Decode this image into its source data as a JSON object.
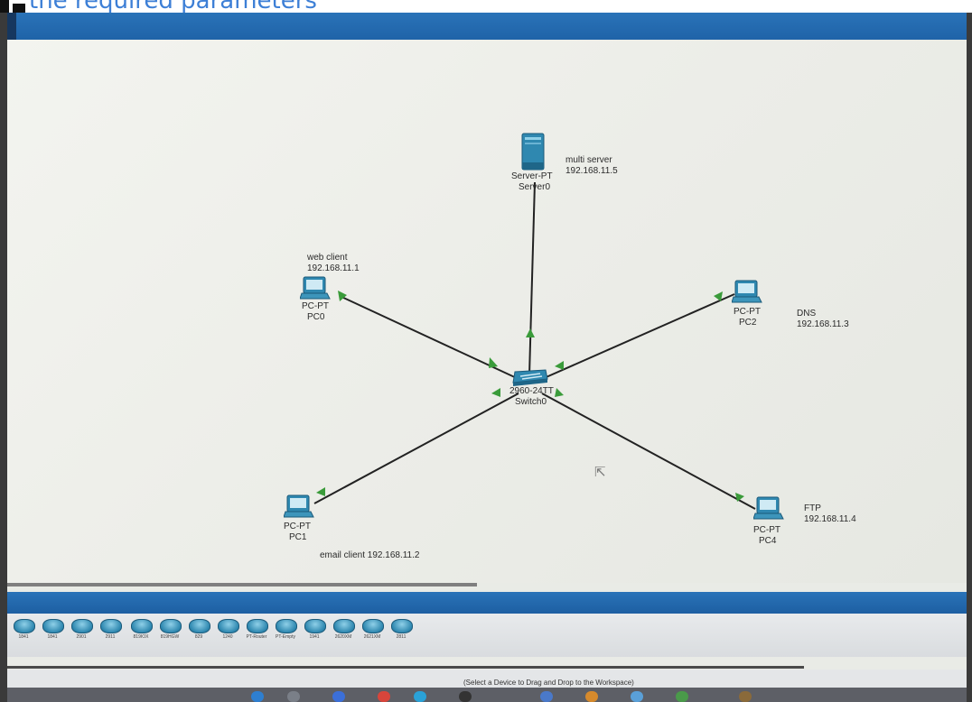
{
  "caption": {
    "partial_text": "the required parameters"
  },
  "devices": [
    {
      "id": "server0",
      "model": "Server-PT",
      "name": "Server0",
      "note_lines": [
        "multi server",
        "192.168.11.5"
      ]
    },
    {
      "id": "pc0",
      "model": "PC-PT",
      "name": "PC0",
      "note_lines": [
        "web client",
        "192.168.11.1"
      ]
    },
    {
      "id": "pc2",
      "model": "PC-PT",
      "name": "PC2",
      "note_lines": [
        "DNS",
        "192.168.11.3"
      ]
    },
    {
      "id": "pc1",
      "model": "PC-PT",
      "name": "PC1",
      "note_lines": [
        "email client 192.168.11.2"
      ]
    },
    {
      "id": "pc4",
      "model": "PC-PT",
      "name": "PC4",
      "note_lines": [
        "FTP",
        "192.168.11.4"
      ]
    },
    {
      "id": "switch0",
      "model": "2960-24TT",
      "name": "Switch0",
      "note_lines": []
    }
  ],
  "device_tray": [
    "1841",
    "2901",
    "2911",
    "819IOX",
    "819HGW",
    "829",
    "1240",
    "PT-Router",
    "PT-Empty",
    "1941",
    "2620XM",
    "2621XM",
    "2811"
  ],
  "status": {
    "text": "(Select a Device to Drag and Drop to the Workspace)"
  },
  "colors": {
    "accent": "#2a73b8",
    "link_up": "#3a9b3a",
    "device_blue": "#2f88b0"
  }
}
